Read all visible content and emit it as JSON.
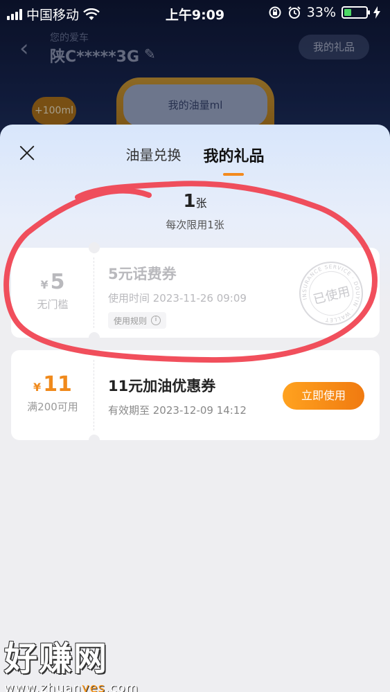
{
  "status_bar": {
    "carrier": "中国移动",
    "time": "上午9:09",
    "battery_percent": "33%",
    "battery_level": 0.33
  },
  "background": {
    "subtitle": "您的爱车",
    "plate": "陕C*****3G",
    "gift_button": "我的礼品",
    "bonus": "+100ml",
    "tank_label": "我的油量ml"
  },
  "sheet": {
    "tabs": [
      {
        "label": "油量兑换",
        "active": false
      },
      {
        "label": "我的礼品",
        "active": true
      }
    ],
    "count_number": "1",
    "count_unit": "张",
    "limit_text": "每次限用1张",
    "coupons": [
      {
        "state": "used",
        "currency": "¥",
        "amount": "5",
        "condition": "无门槛",
        "title": "5元话费券",
        "time_text": "使用时间 2023-11-26 09:09",
        "rule_label": "使用规则",
        "stamp_text": "已使用",
        "stamp_ring_text": "INSURANCE SERVICE · DOUYIN · WALLET"
      },
      {
        "state": "active",
        "currency": "¥",
        "amount": "11",
        "condition": "满200可用",
        "title": "11元加油优惠券",
        "time_text": "有效期至 2023-12-09 14:12",
        "action_label": "立即使用"
      }
    ]
  },
  "watermark": {
    "logo": "好赚网",
    "url_prefix": "www.zhuan",
    "url_highlight": "yes",
    "url_suffix": ".com"
  },
  "colors": {
    "accent_orange": "#f38a1e",
    "annotation_red": "#f0404e"
  }
}
